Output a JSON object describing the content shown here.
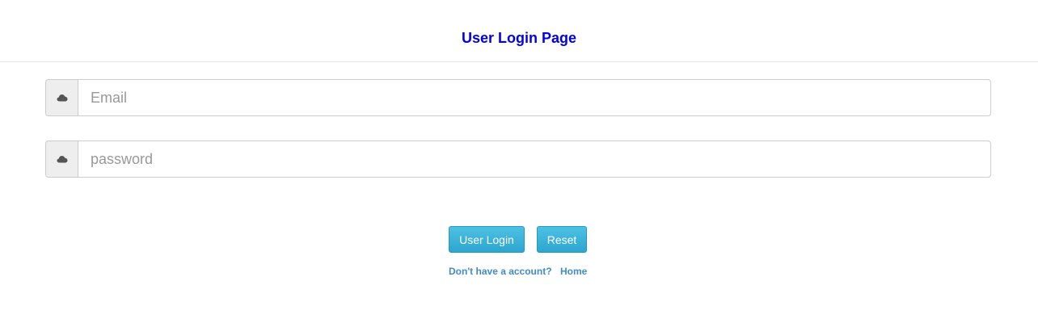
{
  "header": {
    "title": "User Login Page",
    "title_color": "#0000ee"
  },
  "form": {
    "email": {
      "icon": "cloud-icon",
      "placeholder": "Email",
      "value": ""
    },
    "password": {
      "icon": "cloud-icon",
      "placeholder": "password",
      "value": ""
    }
  },
  "buttons": {
    "login_label": "User Login",
    "reset_label": "Reset",
    "color": "#2ba6cf"
  },
  "links": {
    "signup": "Don't have a account?",
    "home": "Home",
    "color": "#428bca"
  }
}
